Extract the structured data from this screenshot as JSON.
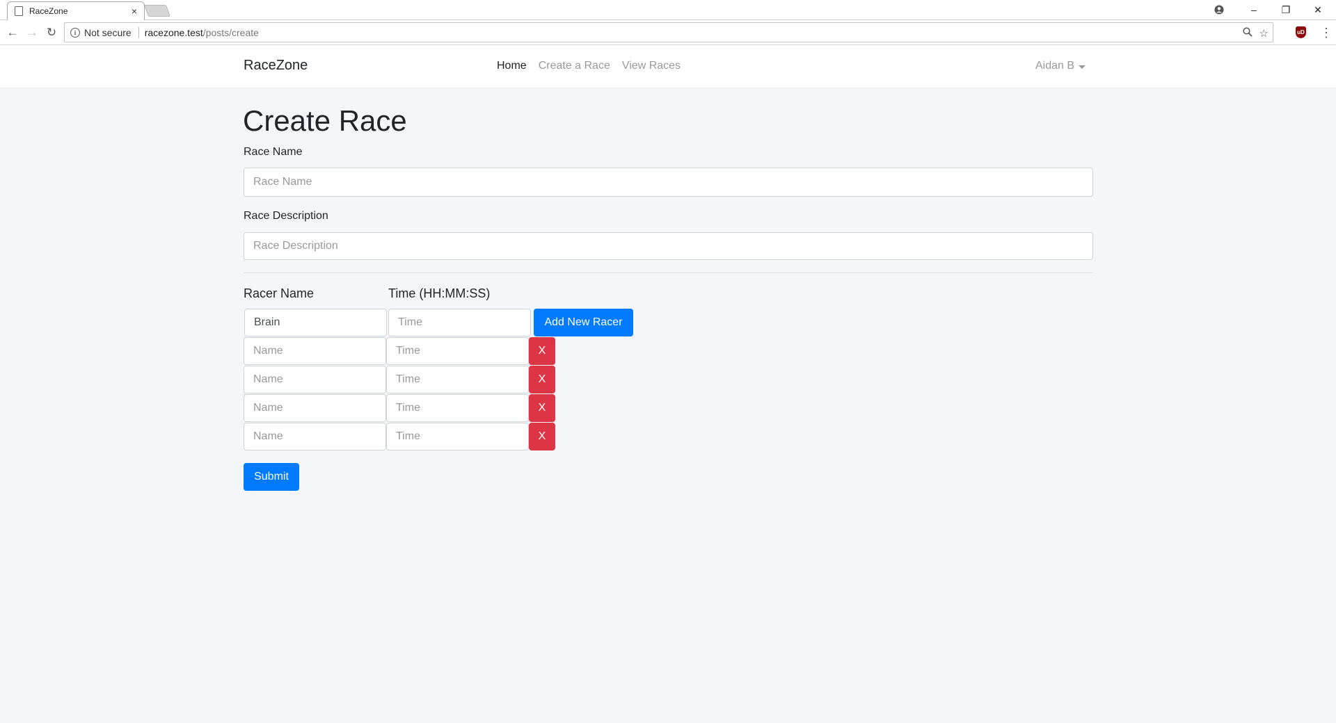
{
  "browser": {
    "tab_title": "RaceZone",
    "tab_close": "×",
    "security_label": "Not secure",
    "url_host": "racezone.test",
    "url_path": "/posts/create",
    "window_controls": [
      "–",
      "❐",
      "✕"
    ],
    "ext_label": "uD"
  },
  "navbar": {
    "brand": "RaceZone",
    "links": [
      "Home",
      "Create a Race",
      "View Races"
    ],
    "active_link": "Home",
    "user": "Aidan B"
  },
  "form": {
    "title": "Create Race",
    "race_name_label": "Race Name",
    "race_name_placeholder": "Race Name",
    "race_desc_label": "Race Description",
    "race_desc_placeholder": "Race Description",
    "racer_name_header": "Racer Name",
    "time_header": "Time (HH:MM:SS)",
    "first_racer_name": "Brain",
    "time_placeholder": "Time",
    "name_placeholder": "Name",
    "add_button": "Add New Racer",
    "remove_button": "X",
    "submit_button": "Submit"
  }
}
